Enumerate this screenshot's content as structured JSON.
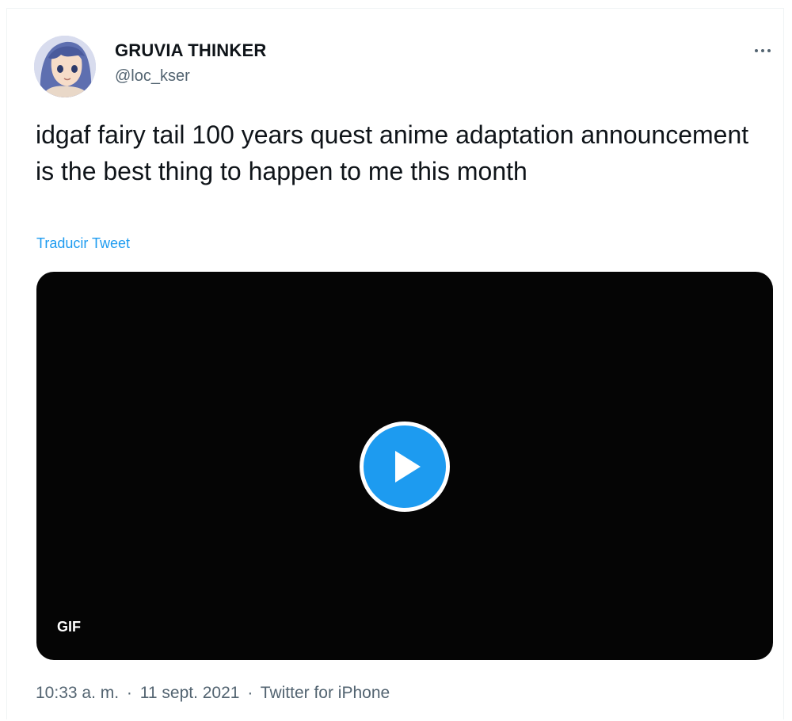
{
  "author": {
    "display_name": "GRUVIA THINKER",
    "handle": "@loc_kser",
    "avatar_icon": "anime-avatar-icon"
  },
  "tweet": {
    "text": "idgaf fairy tail 100 years quest anime adaptation announcement is the best thing to happen to me this month",
    "translate_label": "Traducir Tweet"
  },
  "media": {
    "badge": "GIF",
    "play_icon": "play-icon"
  },
  "meta": {
    "time": "10:33 a. m.",
    "date": "11 sept. 2021",
    "source": "Twitter for iPhone",
    "separator": "·"
  },
  "colors": {
    "accent": "#1d9bf0",
    "text_primary": "#0f1419",
    "text_secondary": "#536471",
    "media_bg": "#050505"
  }
}
